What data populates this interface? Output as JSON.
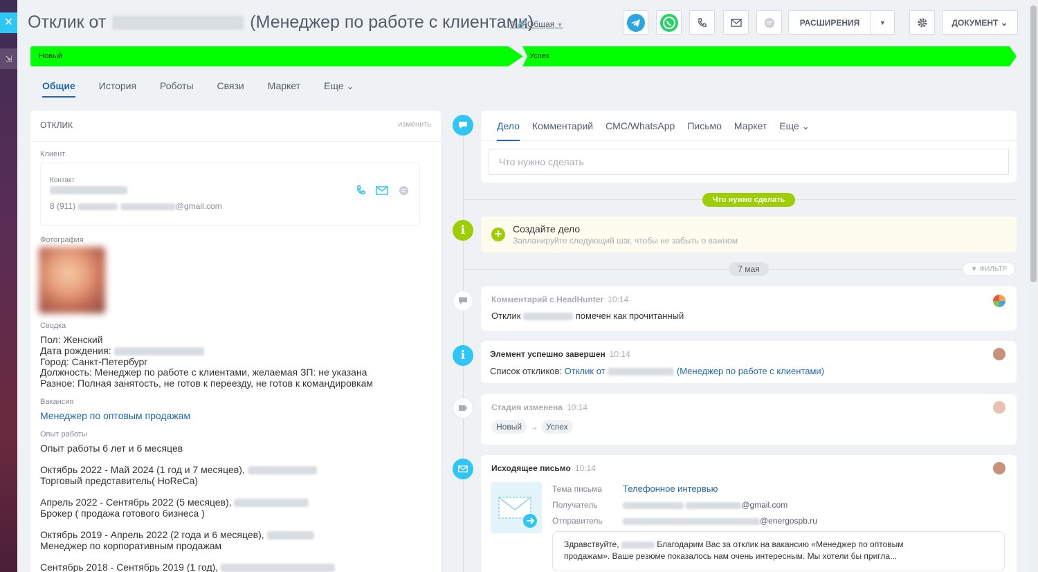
{
  "header": {
    "title_prefix": "Отклик от",
    "title_suffix": "(Менеджер по работе с клиентами)",
    "category": "Общая",
    "extensions_label": "РАСШИРЕНИЯ",
    "document_label": "ДОКУМЕНТ"
  },
  "stages": [
    "Новый",
    "Успех"
  ],
  "tabs": [
    "Общие",
    "История",
    "Роботы",
    "Связи",
    "Маркет",
    "Еще"
  ],
  "left": {
    "card_title": "ОТКЛИК",
    "edit_label": "изменить",
    "client_label": "Клиент",
    "contact_label": "Контакт",
    "phone_prefix": "8 (911)",
    "email_suffix": "@gmail.com",
    "photo_label": "Фотография",
    "summary_label": "Сводка",
    "summary_lines": [
      "Пол: Женский",
      "Дата рождения:",
      "Город: Санкт-Петербург",
      "Должность: Менеджер по работе с клиентами, желаемая ЗП: не указана",
      "Разное: Полная занятость, не готов к переезду, не готов к командировкам"
    ],
    "vacancy_label": "Вакансия",
    "vacancy_value": "Менеджер по оптовым продажам",
    "experience_label": "Опыт работы",
    "experience_total": "Опыт работы 6 лет и 6 месяцев",
    "jobs": [
      {
        "period": "Октябрь 2022 - Май 2024 (1 год и 7 месяцев),",
        "role": "Торговый представитель( HoReCa)"
      },
      {
        "period": "Апрель 2022 - Сентябрь 2022 (5 месяцев),",
        "role": "Брокер ( продажа готового бизнеса )"
      },
      {
        "period": "Октябрь 2019 - Апрель 2022 (2 года и 6 месяцев),",
        "role": "Менеджер по корпоративным продажам"
      },
      {
        "period": "Сентябрь 2018 - Сентябрь 2019 (1 год),",
        "role": ""
      }
    ]
  },
  "right": {
    "tabs": [
      "Дело",
      "Комментарий",
      "СМС/WhatsApp",
      "Письмо",
      "Маркет",
      "Еще"
    ],
    "input_placeholder": "Что нужно сделать",
    "todo_pill": "Что нужно сделать",
    "create_title": "Создайте дело",
    "create_sub": "Запланируйте следующий шаг, чтобы не забыть о важном",
    "date_pill": "7 мая",
    "filter_label": "ФИЛЬТР",
    "events": {
      "comment": {
        "title": "Комментарий с HeadHunter",
        "time": "10:14",
        "text_prefix": "Отклик",
        "text_suffix": "помечен как прочитанный"
      },
      "done": {
        "title": "Элемент успешно завершен",
        "time": "10:14",
        "text_prefix": "Список откликов:",
        "link_prefix": "Отклик от",
        "link_suffix": "(Менеджер по работе с клиентами)"
      },
      "stage": {
        "title": "Стадия изменена",
        "time": "10:14",
        "from": "Новый",
        "to": "Успех"
      },
      "mail": {
        "title": "Исходящее письмо",
        "time": "10:14",
        "subject_label": "Тема письма",
        "subject_value": "Телефонное интервью",
        "recipient_label": "Получатель",
        "recipient_suffix": "@gmail.com",
        "sender_label": "Отправитель",
        "sender_suffix": "@energospb.ru",
        "body_line1_prefix": "Здравствуйте,",
        "body_line1_suffix": "Благодарим Вас за отклик на вакансию «Менеджер по оптовым",
        "body_line2": "продажам». Ваше резюме показалось нам очень интересным. Мы хотели бы пригла..."
      }
    }
  },
  "colors": {
    "stage": "#00ff00",
    "accent": "#2067b0",
    "timeline_blue": "#2fc6f6",
    "timeline_green": "#9dcf00",
    "telegram": "#2ca5e0",
    "whatsapp": "#25d366"
  }
}
